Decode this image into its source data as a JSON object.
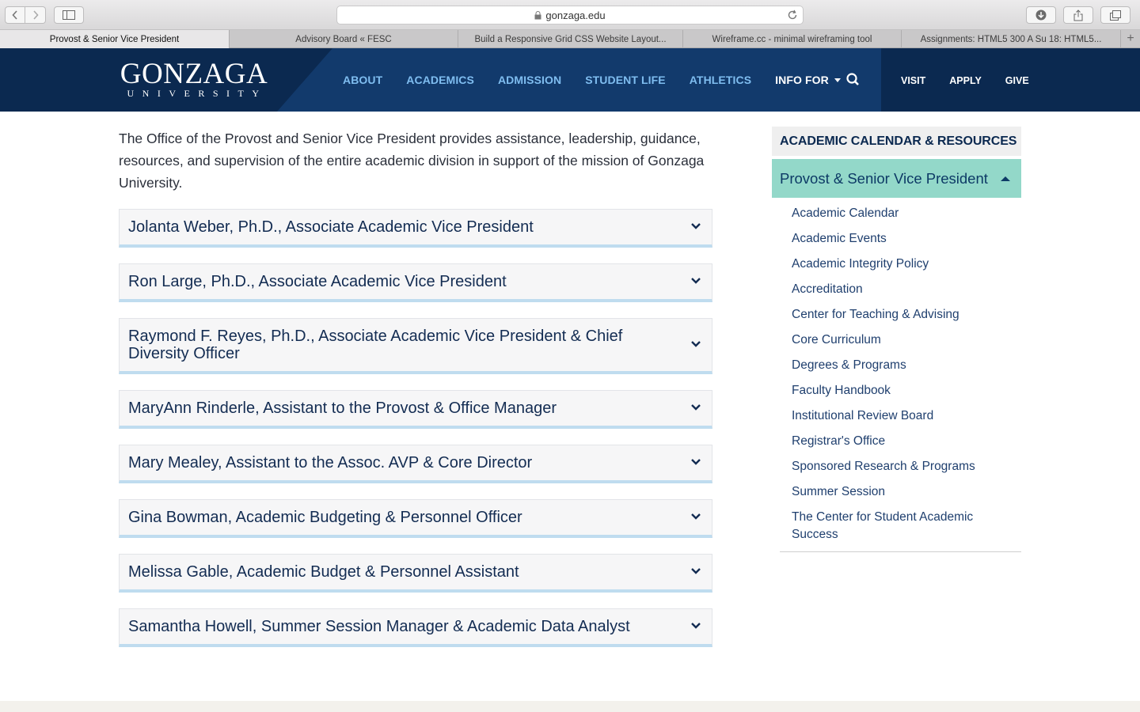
{
  "browser": {
    "url": "gonzaga.edu",
    "tabs": [
      {
        "label": "Provost & Senior Vice President",
        "active": true
      },
      {
        "label": "Advisory Board « FESC",
        "active": false
      },
      {
        "label": "Build a Responsive Grid CSS Website Layout...",
        "active": false
      },
      {
        "label": "Wireframe.cc - minimal wireframing tool",
        "active": false
      },
      {
        "label": "Assignments: HTML5 300 A Su 18: HTML5...",
        "active": false
      }
    ],
    "add_tab": "+"
  },
  "header": {
    "logo_main": "GONZAGA",
    "logo_sub": "UNIVERSITY",
    "nav": [
      "ABOUT",
      "ACADEMICS",
      "ADMISSION",
      "STUDENT LIFE",
      "ATHLETICS",
      "INFO FOR"
    ],
    "util": [
      "VISIT",
      "APPLY",
      "GIVE"
    ]
  },
  "main": {
    "intro": "The Office of the Provost and Senior Vice President provides assistance, leadership, guidance, resources, and supervision of the entire academic division in support of the mission of Gonzaga University.",
    "staff": [
      "Jolanta Weber, Ph.D., Associate Academic Vice President",
      "Ron Large, Ph.D., Associate Academic Vice President",
      "Raymond F. Reyes, Ph.D., Associate Academic Vice President & Chief Diversity Officer",
      "MaryAnn Rinderle, Assistant to the Provost & Office Manager",
      "Mary Mealey, Assistant to the Assoc. AVP & Core Director",
      "Gina Bowman, Academic Budgeting & Personnel Officer",
      "Melissa Gable, Academic Budget & Personnel Assistant",
      "Samantha Howell, Summer Session Manager & Academic Data Analyst"
    ]
  },
  "sidebar": {
    "heading": "ACADEMIC CALENDAR & RESOURCES",
    "active": "Provost & Senior Vice President",
    "links": [
      "Academic Calendar",
      "Academic Events",
      "Academic Integrity Policy",
      "Accreditation",
      "Center for Teaching & Advising",
      "Core Curriculum",
      "Degrees & Programs",
      "Faculty Handbook",
      "Institutional Review Board",
      "Registrar's Office",
      "Sponsored Research & Programs",
      "Summer Session",
      "The Center for Student Academic Success"
    ]
  },
  "colors": {
    "header_bg": "#0b2950",
    "nav_link": "#7fbdf0",
    "active_item": "#93d8c9",
    "accordion_underline": "#bfdcef"
  }
}
